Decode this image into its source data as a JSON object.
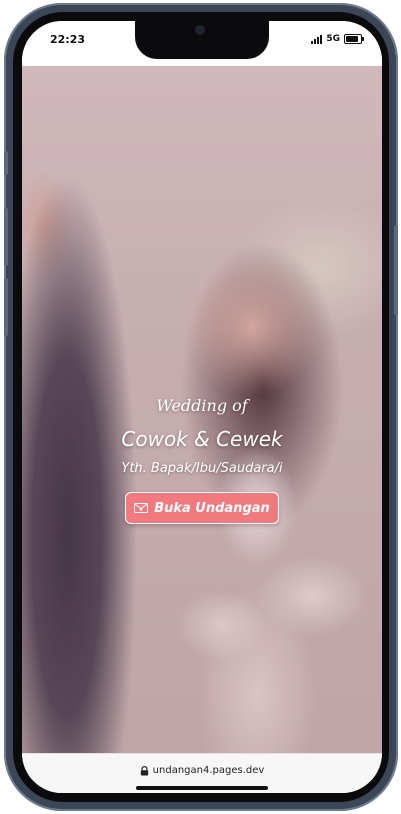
{
  "status_bar": {
    "time": "22:23",
    "network": "5G"
  },
  "hero": {
    "wedding_of": "Wedding of",
    "couple": "Cowok & Cewek",
    "recipient": "Yth. Bapak/Ibu/Saudara/i",
    "open_button_label": "Buka Undangan",
    "open_button_icon": "envelope-heart-icon",
    "accent_color": "#f07a7e"
  },
  "browser": {
    "url": "undangan4.pages.dev",
    "secure_icon": "lock-icon"
  }
}
